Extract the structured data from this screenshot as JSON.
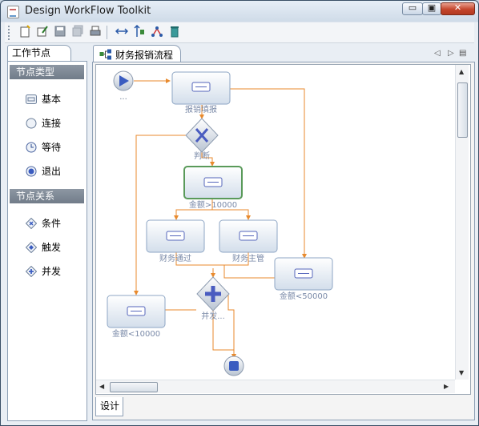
{
  "window": {
    "title": "Design WorkFlow Toolkit",
    "min_glyph": "▭",
    "max_glyph": "▣",
    "close_glyph": "✕"
  },
  "palette": {
    "title": "工作节点",
    "categories": [
      {
        "label": "节点类型",
        "items": [
          {
            "label": "基本",
            "icon": "basic-node-icon"
          },
          {
            "label": "连接",
            "icon": "connection-node-icon"
          },
          {
            "label": "等待",
            "icon": "wait-node-icon"
          },
          {
            "label": "退出",
            "icon": "exit-node-icon"
          }
        ]
      },
      {
        "label": "节点关系",
        "items": [
          {
            "label": "条件",
            "icon": "condition-icon"
          },
          {
            "label": "触发",
            "icon": "trigger-icon"
          },
          {
            "label": "并发",
            "icon": "concurrent-icon"
          }
        ]
      }
    ]
  },
  "editor": {
    "tab_label": "财务报销流程",
    "bottom_tab": "设计"
  },
  "diagram": {
    "start_label": "...",
    "node_baoxiao": "报销填报",
    "decision_label": "判断",
    "node_gt10000": "金额>10000",
    "node_approved": "财务通过",
    "node_supervisor": "财务主管",
    "node_lt50000": "金额<50000",
    "parallel_label": "并发...",
    "node_lt10000": "金额<10000"
  },
  "colors": {
    "edge": "#e88a2e",
    "node_border": "#8ea6c4",
    "node_selected_border": "#5a9a5a",
    "label": "#7a8aa8",
    "symbol": "#5566bb"
  }
}
